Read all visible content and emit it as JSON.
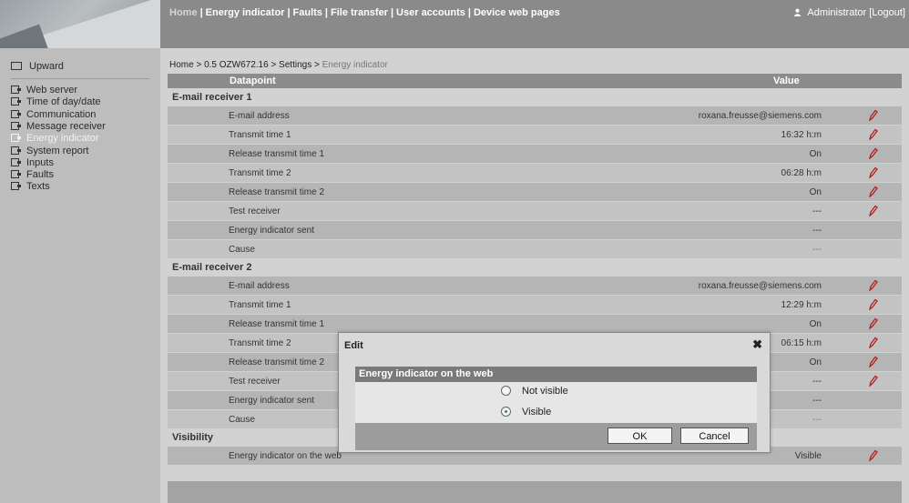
{
  "topnav": {
    "items": [
      "Home",
      "Energy indicator",
      "Faults",
      "File transfer",
      "User accounts",
      "Device web pages"
    ],
    "user": "Administrator",
    "logout": "[Logout]"
  },
  "sidebar": {
    "upward": "Upward",
    "items": [
      {
        "label": "Web server"
      },
      {
        "label": "Time of day/date"
      },
      {
        "label": "Communication"
      },
      {
        "label": "Message receiver"
      },
      {
        "label": "Energy indicator",
        "active": true
      },
      {
        "label": "System report"
      },
      {
        "label": "Inputs"
      },
      {
        "label": "Faults"
      },
      {
        "label": "Texts"
      }
    ]
  },
  "breadcrumb": {
    "path": "Home > 0.5 OZW672.16 > Settings > ",
    "current": "Energy indicator"
  },
  "table": {
    "headers": {
      "datapoint": "Datapoint",
      "value": "Value"
    },
    "sections": [
      {
        "title": "E-mail receiver 1",
        "rows": [
          {
            "dp": "E-mail address",
            "val": "roxana.freusse@siemens.com",
            "edit": true
          },
          {
            "dp": "Transmit time 1",
            "val": "16:32 h:m",
            "edit": true
          },
          {
            "dp": "Release transmit time 1",
            "val": "On",
            "edit": true
          },
          {
            "dp": "Transmit time 2",
            "val": "06:28 h:m",
            "edit": true
          },
          {
            "dp": "Release transmit time 2",
            "val": "On",
            "edit": true
          },
          {
            "dp": "Test receiver",
            "val": "---",
            "edit": true
          },
          {
            "dp": "Energy indicator sent",
            "val": "---",
            "edit": false
          },
          {
            "dp": "Cause",
            "val": "---",
            "edit": false,
            "dim": true
          }
        ]
      },
      {
        "title": "E-mail receiver 2",
        "rows": [
          {
            "dp": "E-mail address",
            "val": "roxana.freusse@siemens.com",
            "edit": true
          },
          {
            "dp": "Transmit time 1",
            "val": "12:29 h:m",
            "edit": true
          },
          {
            "dp": "Release transmit time 1",
            "val": "On",
            "edit": true
          },
          {
            "dp": "Transmit time 2",
            "val": "06:15 h:m",
            "edit": true
          },
          {
            "dp": "Release transmit time 2",
            "val": "On",
            "edit": true
          },
          {
            "dp": "Test receiver",
            "val": "---",
            "edit": true
          },
          {
            "dp": "Energy indicator sent",
            "val": "---",
            "edit": false
          },
          {
            "dp": "Cause",
            "val": "---",
            "edit": false,
            "dim": true
          }
        ]
      },
      {
        "title": "Visibility",
        "rows": [
          {
            "dp": "Energy indicator on the web",
            "val": "Visible",
            "edit": true
          }
        ]
      }
    ]
  },
  "dialog": {
    "title": "Edit",
    "header": "Energy indicator on the web",
    "options": [
      {
        "label": "Not visible",
        "checked": false
      },
      {
        "label": "Visible",
        "checked": true
      }
    ],
    "ok": "OK",
    "cancel": "Cancel"
  },
  "colors": {
    "edit_icon": "#b02020",
    "radio_selected": "#3a8a3a"
  }
}
